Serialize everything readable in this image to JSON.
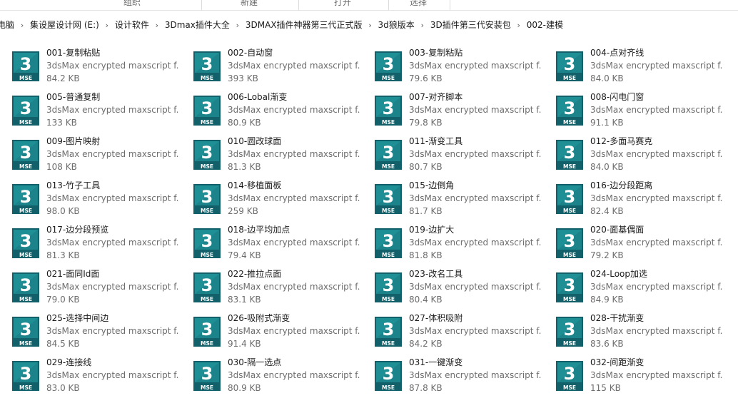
{
  "ribbon": {
    "groups": [
      "组织",
      "新建",
      "打开",
      "选择"
    ]
  },
  "breadcrumb": [
    "电脑",
    "集设屋设计网 (E:)",
    "设计软件",
    "3Dmax插件大全",
    "3DMAX插件神器第三代正式版",
    "3d狼版本",
    "3D插件第三代安装包",
    "002-建模"
  ],
  "file_type_label": "3dsMax encrypted maxscript f...",
  "icon": {
    "digit": "3",
    "badge": "MSE",
    "color_main": "#1f8f96",
    "color_dark": "#11606a"
  },
  "files": [
    {
      "name": "001-复制粘贴",
      "size": "84.2 KB"
    },
    {
      "name": "002-自动窗",
      "size": "393 KB"
    },
    {
      "name": "003-复制粘贴",
      "size": "79.6 KB"
    },
    {
      "name": "004-点对齐线",
      "size": "84.0 KB"
    },
    {
      "name": "005-普通复制",
      "size": "133 KB"
    },
    {
      "name": "006-Lobal渐变",
      "size": "80.9 KB"
    },
    {
      "name": "007-对齐脚本",
      "size": "79.8 KB"
    },
    {
      "name": "008-闪电门窗",
      "size": "91.1 KB"
    },
    {
      "name": "009-图片映射",
      "size": "108 KB"
    },
    {
      "name": "010-圆改球面",
      "size": "81.3 KB"
    },
    {
      "name": "011-渐变工具",
      "size": "80.7 KB"
    },
    {
      "name": "012-多面马赛克",
      "size": "84.0 KB"
    },
    {
      "name": "013-竹子工具",
      "size": "98.0 KB"
    },
    {
      "name": "014-移植面板",
      "size": "259 KB"
    },
    {
      "name": "015-边倒角",
      "size": "81.7 KB"
    },
    {
      "name": "016-边分段距离",
      "size": "82.4 KB"
    },
    {
      "name": "017-边分段预览",
      "size": "81.3 KB"
    },
    {
      "name": "018-边平均加点",
      "size": "79.4 KB"
    },
    {
      "name": "019-边扩大",
      "size": "81.8 KB"
    },
    {
      "name": "020-面基偶面",
      "size": "79.2 KB"
    },
    {
      "name": "021-面同Id面",
      "size": "79.0 KB"
    },
    {
      "name": "022-推拉点面",
      "size": "83.1 KB"
    },
    {
      "name": "023-改名工具",
      "size": "80.4 KB"
    },
    {
      "name": "024-Loop加选",
      "size": "84.9 KB"
    },
    {
      "name": "025-选择中间边",
      "size": "84.5 KB"
    },
    {
      "name": "026-吸附式渐变",
      "size": "91.4 KB"
    },
    {
      "name": "027-体积吸附",
      "size": "84.2 KB"
    },
    {
      "name": "028-干扰渐变",
      "size": "83.6 KB"
    },
    {
      "name": "029-连接线",
      "size": "83.0 KB"
    },
    {
      "name": "030-隔一选点",
      "size": "80.9 KB"
    },
    {
      "name": "031-一键渐变",
      "size": "87.8 KB"
    },
    {
      "name": "032-间距渐变",
      "size": "115 KB"
    }
  ]
}
